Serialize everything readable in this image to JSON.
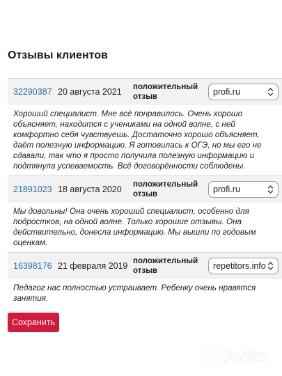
{
  "section": {
    "title": "Отзывы клиентов"
  },
  "reviews": [
    {
      "id": "32290387",
      "date": "20 августа 2021",
      "type": "положительный отзыв",
      "source": "profi.ru",
      "text": "Хороший специалист. Мне всё понравилось. Очень хорошо объясняет, находится с учениками на одной волне, с ней комфортно себя чувствуешь. Достаточно хорошо объясняет, даёт полезную информацию. Я готовилась к ОГЭ, но мы его не сдавали, так что я просто получила полезную информацию и подтянула успеваемость. Всё договорённости соблюдены."
    },
    {
      "id": "21891023",
      "date": "18 августа 2020",
      "type": "положительный отзыв",
      "source": "profi.ru",
      "text": "Мы довольны! Она очень хороший специалист, особенно для подростков, на одной волне. Только хорошие отзывы. Она действительно, донесла информацию. Мы вышли по годовым оценкам."
    },
    {
      "id": "16398176",
      "date": "21 февраля 2019",
      "type": "положительный отзыв",
      "source": "repetitors.info",
      "text": "Педагог нас полностью устраивает. Ребенку очень нравятся занятия."
    }
  ],
  "actions": {
    "save_label": "Сохранить"
  },
  "watermark": {
    "text": "Avito",
    "icon": "avito-logo-icon"
  },
  "colors": {
    "link": "#2a6fb0",
    "button": "#d21a3a",
    "header_bg": "#f2f2f2"
  }
}
